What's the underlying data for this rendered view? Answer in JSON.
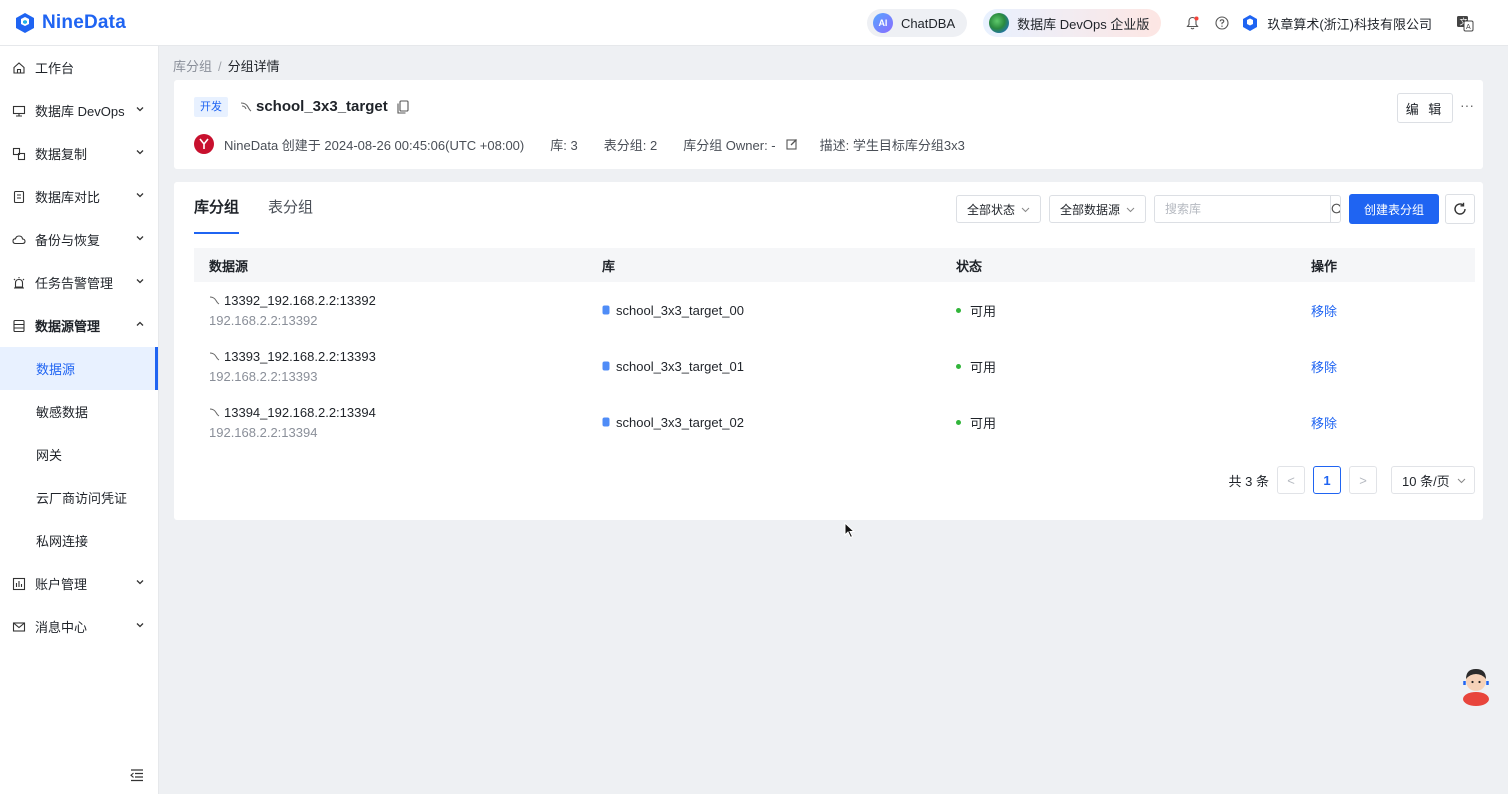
{
  "app": {
    "name": "NineData",
    "chat_label": "ChatDBA",
    "chat_badge": "AI",
    "edition_label": "数据库 DevOps 企业版",
    "company": "玖章算术(浙江)科技有限公司"
  },
  "sidebar": {
    "items": [
      {
        "label": "工作台"
      },
      {
        "label": "数据库 DevOps"
      },
      {
        "label": "数据复制"
      },
      {
        "label": "数据库对比"
      },
      {
        "label": "备份与恢复"
      },
      {
        "label": "任务告警管理"
      },
      {
        "label": "数据源管理"
      },
      {
        "label": "账户管理"
      },
      {
        "label": "消息中心"
      }
    ],
    "sub_items": [
      {
        "label": "数据源"
      },
      {
        "label": "敏感数据"
      },
      {
        "label": "网关"
      },
      {
        "label": "云厂商访问凭证"
      },
      {
        "label": "私网连接"
      }
    ]
  },
  "breadcrumb": {
    "parent": "库分组",
    "separator": "/",
    "current": "分组详情"
  },
  "group": {
    "env_tag": "开发",
    "name": "school_3x3_target",
    "edit_label": "编 辑",
    "more_label": "···",
    "creator_text": "NineData 创建于 2024-08-26 00:45:06(UTC +08:00)",
    "db_count": "库: 3",
    "table_group_count": "表分组: 2",
    "owner_text": "库分组 Owner: -",
    "description": "描述: 学生目标库分组3x3"
  },
  "tabs": [
    {
      "label": "库分组",
      "active": true
    },
    {
      "label": "表分组",
      "active": false
    }
  ],
  "filters": {
    "status": "全部状态",
    "datasource": "全部数据源",
    "search_placeholder": "搜索库",
    "create_label": "创建表分组"
  },
  "table": {
    "headers": [
      "数据源",
      "库",
      "状态",
      "操作"
    ],
    "rows": [
      {
        "ds_name": "13392_192.168.2.2:13392",
        "ds_addr": "192.168.2.2:13392",
        "db": "school_3x3_target_00",
        "status": "可用",
        "action": "移除"
      },
      {
        "ds_name": "13393_192.168.2.2:13393",
        "ds_addr": "192.168.2.2:13393",
        "db": "school_3x3_target_01",
        "status": "可用",
        "action": "移除"
      },
      {
        "ds_name": "13394_192.168.2.2:13394",
        "ds_addr": "192.168.2.2:13394",
        "db": "school_3x3_target_02",
        "status": "可用",
        "action": "移除"
      }
    ]
  },
  "pagination": {
    "total": "共 3 条",
    "prev": "<",
    "current_page": "1",
    "next": ">",
    "page_size": "10 条/页"
  },
  "colors": {
    "primary": "#1f64f2",
    "status_ok": "#31b53a",
    "background": "#eef0f3"
  }
}
